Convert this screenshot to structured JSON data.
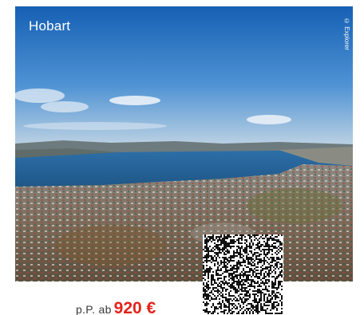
{
  "card": {
    "title": "Hobart",
    "credit": "© Explorer",
    "price_prefix": "p.P. ab",
    "price_value": "920 €",
    "accent_color": "#e2231a"
  },
  "qr_code": {
    "icon": "qr-code-icon"
  }
}
